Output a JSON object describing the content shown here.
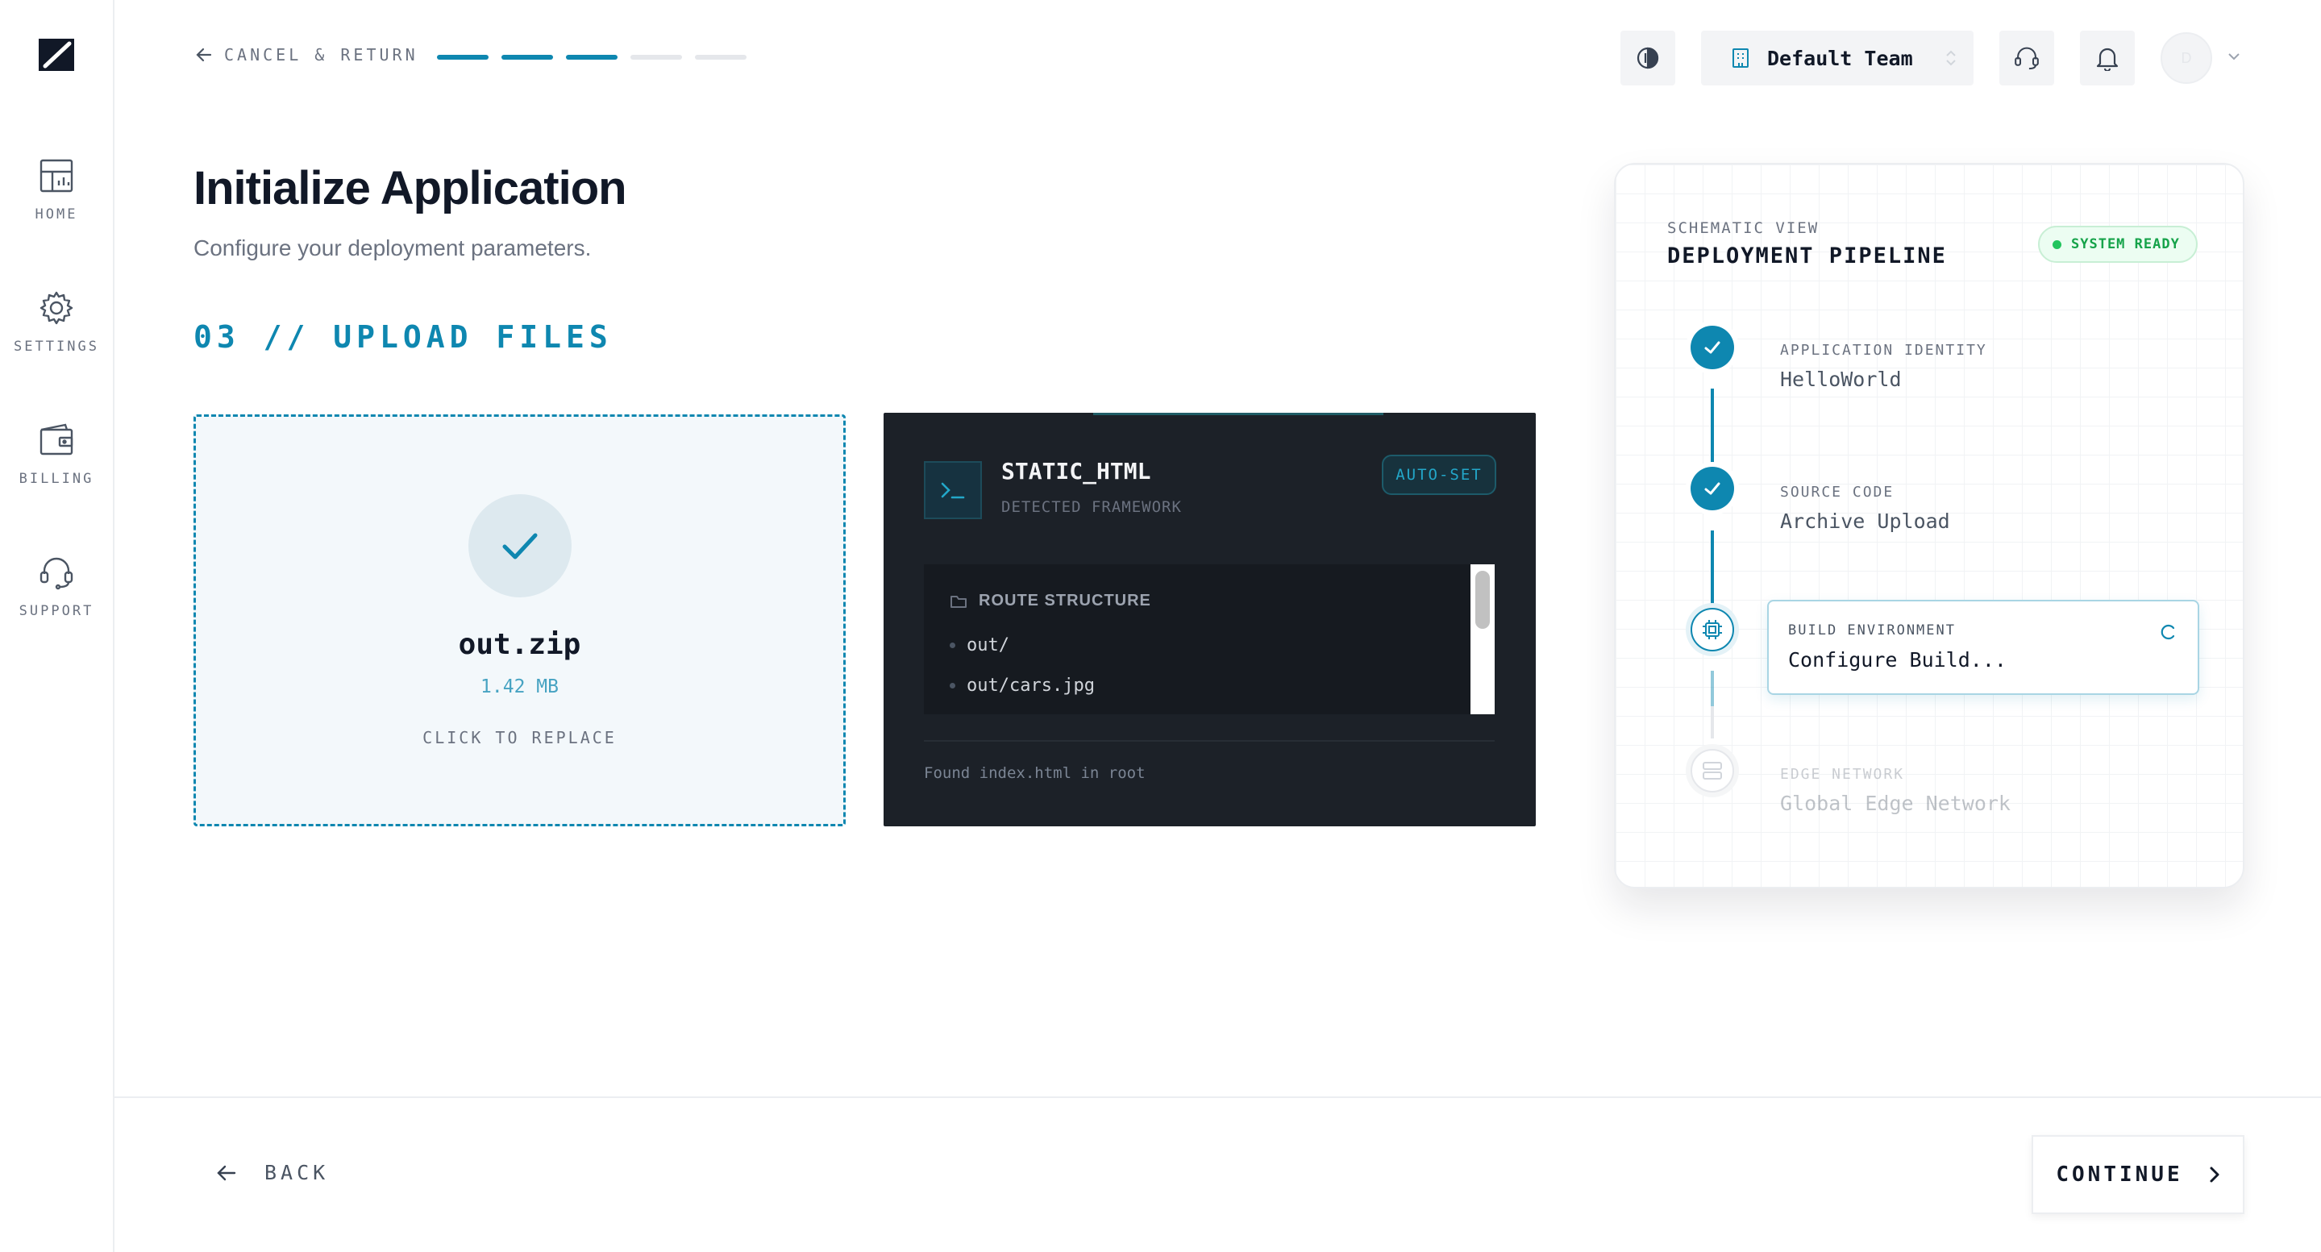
{
  "nav": {
    "items": [
      {
        "label": "HOME",
        "icon": "dashboard-icon"
      },
      {
        "label": "SETTINGS",
        "icon": "gear-icon"
      },
      {
        "label": "BILLING",
        "icon": "wallet-icon"
      },
      {
        "label": "SUPPORT",
        "icon": "headset-icon"
      }
    ]
  },
  "topbar": {
    "cancel_label": "CANCEL & RETURN",
    "progress": {
      "completed_steps": 3,
      "total_steps": 5
    },
    "team_name": "Default Team",
    "avatar_initial": "D"
  },
  "page": {
    "title": "Initialize Application",
    "subtitle": "Configure your deployment parameters.",
    "step_title": "03 // UPLOAD FILES"
  },
  "upload": {
    "file_name": "out.zip",
    "file_size": "1.42 MB",
    "replace_label": "CLICK TO REPLACE"
  },
  "framework": {
    "name": "STATIC_HTML",
    "detected_label": "DETECTED FRAMEWORK",
    "badge": "AUTO-SET",
    "routes_title": "ROUTE STRUCTURE",
    "routes": [
      "out/",
      "out/cars.jpg"
    ],
    "footer": "Found index.html in root"
  },
  "pipeline": {
    "kicker": "SCHEMATIC VIEW",
    "title": "DEPLOYMENT PIPELINE",
    "status": "SYSTEM READY",
    "steps": [
      {
        "label": "APPLICATION IDENTITY",
        "value": "HelloWorld",
        "state": "done"
      },
      {
        "label": "SOURCE CODE",
        "value": "Archive Upload",
        "state": "done"
      },
      {
        "label": "BUILD ENVIRONMENT",
        "value": "Configure Build...",
        "state": "active"
      },
      {
        "label": "EDGE NETWORK",
        "value": "Global Edge Network",
        "state": "pending"
      }
    ]
  },
  "footer": {
    "back_label": "BACK",
    "continue_label": "CONTINUE"
  },
  "colors": {
    "accent": "#0e87b0",
    "success": "#16a34a",
    "dark_card": "#1c2128"
  }
}
